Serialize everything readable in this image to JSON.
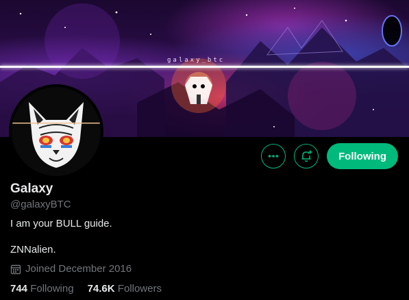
{
  "banner": {
    "text": "galaxy_btc"
  },
  "profile": {
    "name": "Galaxy",
    "handle": "@galaxyBTC",
    "bio_line1": "I am your BULL guide.",
    "bio_line2": "ZNNalien.",
    "joined": "Joined December 2016"
  },
  "stats": {
    "following_count": "744",
    "following_label": "Following",
    "followers_count": "74.6K",
    "followers_label": "Followers"
  },
  "actions": {
    "more_icon": "ellipsis-icon",
    "notify_icon": "bell-plus-icon",
    "follow_label": "Following"
  },
  "colors": {
    "accent": "#00ba7c",
    "text_primary": "#e7e9ea",
    "text_secondary": "#71767b",
    "background": "#000000"
  }
}
